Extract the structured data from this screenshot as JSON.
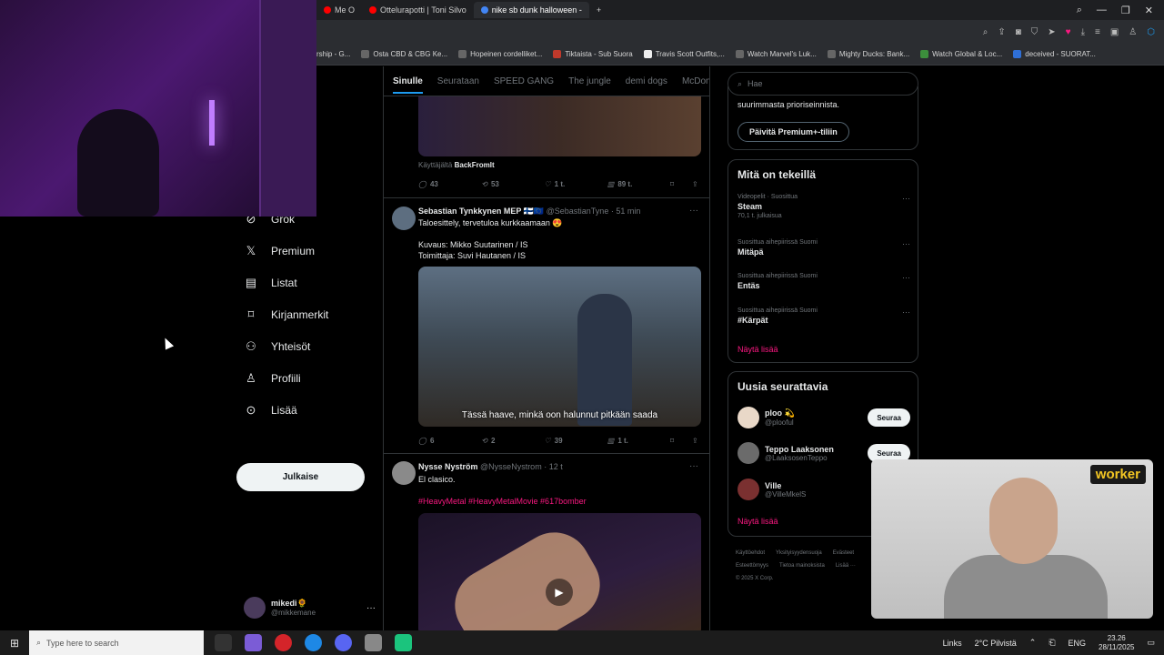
{
  "browser": {
    "tabs": [
      {
        "label": "Me O",
        "active": false,
        "color": "#ff0000"
      },
      {
        "label": "Ottelurapotti | Toni Silvo",
        "active": false,
        "color": "#ff0000"
      },
      {
        "label": "nike sb dunk halloween -",
        "active": true,
        "color": "#4285f4"
      }
    ],
    "new_tab": "+",
    "bookmarks": [
      "rship - G...",
      "Osta CBD & CBG Ke...",
      "Hopeinen cordelliket...",
      "Tiktaista - Sub Suora",
      "Travis Scott Outfits,...",
      "Watch Marvel's Luk...",
      "Mighty Ducks: Bank...",
      "Watch Global & Loc...",
      "deceived - SUORAT..."
    ]
  },
  "nav": {
    "items": [
      {
        "icon": "grok-icon",
        "glyph": "⊘",
        "label": "Grok"
      },
      {
        "icon": "x-premium-icon",
        "glyph": "𝕏",
        "label": "Premium"
      },
      {
        "icon": "lists-icon",
        "glyph": "▤",
        "label": "Listat"
      },
      {
        "icon": "bookmark-icon",
        "glyph": "⌑",
        "label": "Kirjanmerkit"
      },
      {
        "icon": "communities-icon",
        "glyph": "⚇",
        "label": "Yhteisöt"
      },
      {
        "icon": "profile-icon",
        "glyph": "♙",
        "label": "Profiili"
      },
      {
        "icon": "more-icon",
        "glyph": "⊙",
        "label": "Lisää"
      }
    ],
    "post_button": "Julkaise",
    "account": {
      "name": "mikedi🌻",
      "handle": "@mikkemane",
      "more": "···"
    }
  },
  "feed": {
    "tabs": [
      "Sinulle",
      "Seurataan",
      "SPEED GANG",
      "The jungle",
      "demi dogs",
      "McDonal"
    ],
    "post1": {
      "via_prefix": "Käyttäjältä",
      "via_user": "BackFromIt",
      "replies": "43",
      "reposts": "53",
      "likes": "1 t.",
      "views": "89 t."
    },
    "post2": {
      "name": "Sebastian Tynkkynen MEP 🇫🇮🇪🇺",
      "handle": "@SebastianTyne",
      "time": "· 51 min",
      "line1": "Taloesittely, tervetuloa kurkkaamaan 😍",
      "line2": "Kuvaus: Mikko Suutarinen / IS",
      "line3": "Toimittaja: Suvi Hautanen / IS",
      "caption": "Tässä haave, minkä oon halunnut pitkään saada",
      "replies": "6",
      "reposts": "2",
      "likes": "39",
      "views": "1 t."
    },
    "post3": {
      "name": "Nysse Nyström",
      "handle": "@NysseNystrom",
      "time": "· 12 t",
      "text": "El clasico.",
      "hashtags": "#HeavyMetal #HeavyMetalMovie #617bomber"
    }
  },
  "sidebar": {
    "search_placeholder": "Hae",
    "premium_text": "suurimmasta prioriseinnista.",
    "premium_button": "Päivitä Premium+-tiliin",
    "trends_title": "Mitä on tekeillä",
    "trends": [
      {
        "context": "Videopelit · Suosittua",
        "name": "Steam",
        "sub": "70,1 t. julkaisua"
      },
      {
        "context": "Suosittua aihepiirissä Suomi",
        "name": "Mitäpä",
        "sub": ""
      },
      {
        "context": "Suosittua aihepiirissä Suomi",
        "name": "Entäs",
        "sub": ""
      },
      {
        "context": "Suosittua aihepiirissä Suomi",
        "name": "#Kärpät",
        "sub": ""
      }
    ],
    "show_more": "Näytä lisää",
    "follow_title": "Uusia seurattavia",
    "follow": [
      {
        "name": "ploo 💫",
        "handle": "@plooful",
        "button": "Seuraa"
      },
      {
        "name": "Teppo Laaksonen",
        "handle": "@LaaksosenTeppo",
        "button": "Seuraa"
      },
      {
        "name": "Ville",
        "handle": "@VilleMkelS",
        "button": ""
      }
    ],
    "show_more2": "Näytä lisää",
    "footer": [
      "Käyttöehdot",
      "Yksityisyydensuoja",
      "Evästeet",
      "Esteettömyys",
      "Tietoa mainoksista",
      "Lisää ···",
      "© 2025 X Corp."
    ]
  },
  "overlays": {
    "worker_label": "worker"
  },
  "taskbar": {
    "search_placeholder": "Type here to search",
    "links": "Links",
    "weather": "2°C Pilvistä",
    "lang": "ENG",
    "time": "23.26",
    "date": "28/11/2025"
  },
  "colors": {
    "accent": "#1d9bf0",
    "pink": "#f91880",
    "bg": "#000000"
  }
}
